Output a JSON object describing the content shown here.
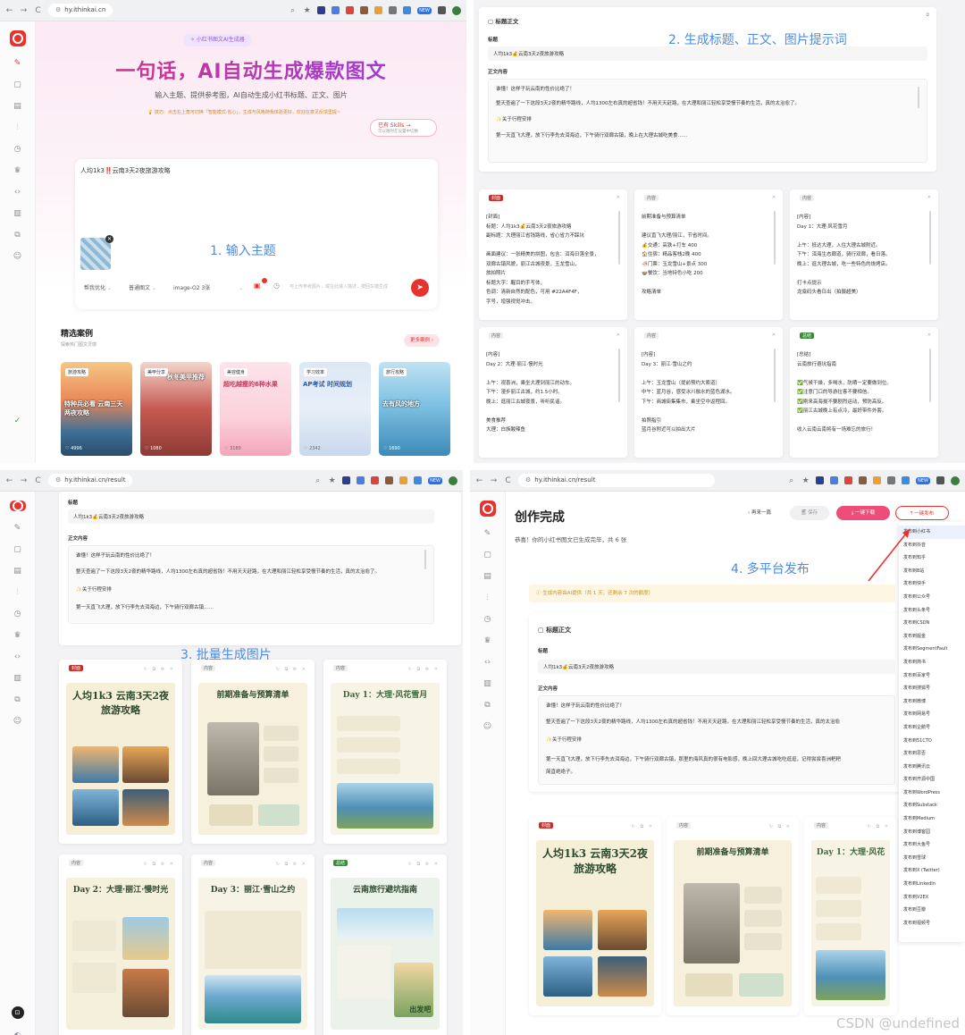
{
  "browser": {
    "url_home": "hy.ithinkai.cn",
    "url_result": "hy.ithinkai.cn/result",
    "nav": [
      "←",
      "→",
      "C"
    ]
  },
  "colors": {
    "brand": "#e8322e",
    "accent_blue": "#4a8ce6",
    "purple": "#9a56d6"
  },
  "p1": {
    "pill": "✧ 小红书图文AI生成器",
    "title": "一句话，AI自动生成爆款图文",
    "subtitle": "输入主题、提供参考图，AI自动生成小红书标题、正文、图片",
    "tip": "💡 技巧：点击右上角可切换「智能模式·省心」，生成与风格随我体验更好，欢迎在意见反馈里提~",
    "skill_line1": "已有 Skills →",
    "skill_line2": "可以随时在设置中切换",
    "input_text": "人均1k3‼️云南3天2夜旅游攻略",
    "step_label": "1. 输入主题",
    "ctrl_style": "帮我优化",
    "ctrl_type": "普通图文",
    "ctrl_model": "image-O2 3张",
    "placeholder": "可上传参考图片，或在此输入描述，按回车键生成",
    "section_title": "精选案例",
    "section_sub": "探索热门图文灵感",
    "more_btn": "更多案例 ›",
    "cases": [
      {
        "tag": "旅游攻略",
        "title": "特种兵必看 云南三天两夜攻略",
        "stat": "♡ 4996"
      },
      {
        "tag": "美甲分享",
        "title": "秋冬美甲推荐",
        "stat": "♡ 1080"
      },
      {
        "tag": "美容健身",
        "title": "超吃越瘦的6种水果",
        "stat": "♡ 3180"
      },
      {
        "tag": "学习效率",
        "title": "AP考试 时间规划",
        "stat": "♡ 2342"
      },
      {
        "tag": "旅行攻略",
        "title": "去有风的地方",
        "stat": "♡ 1690"
      }
    ]
  },
  "p2": {
    "header": "标题正文",
    "step_label": "2. 生成标题、正文、图片提示词",
    "title_label": "标题",
    "title_value": "人均1k3💰云南3天2夜旅游攻略",
    "body_label": "正文内容",
    "body_lines": [
      "谁懂！这样子玩云南的性价比绝了！",
      "整天查遍了一下这段3天2夜的精华路线，人均1300左右真的超省钱！不用天天赶路，在大理和丽江轻松享受慢节奏的生活，真的太治愈了。",
      "✨关于行程安排",
      "第一天直飞大理，放下行李先去洱海边，下午骑行双廊古镇，晚上在大理古城吃美食……"
    ],
    "pages": [
      {
        "tag": "封面",
        "style": "red",
        "lines": [
          "[封面]",
          "标题：人均1k3💰云南3天2夜旅游攻略",
          "副标题：大理丽江省钱路线，省心省力不踩坑",
          "",
          "画面建议：一张精美的拼图，包含：洱海日落全景，",
          "双廊古镇风貌，丽江古城夜景，玉龙雪山，",
          "旅拍照片",
          "标题大字：醒目的手写体，",
          "色调：清新自然的配色，可用 #22A4F4F，",
          "字号，增强视觉冲击。"
        ]
      },
      {
        "tag": "内容",
        "style": "gray",
        "lines": [
          "前期准备与预算清单",
          "",
          "建议直飞大理/丽江，节省时间。",
          "💰交通：高铁+打车 400",
          "🏠住宿：精品客栈2晚 400",
          "🍜门票：玉龙雪山+景点 300",
          "🍲餐饮：当地特色小吃 200",
          "",
          "攻略清单"
        ]
      },
      {
        "tag": "内容",
        "style": "gray",
        "lines": [
          "[内容]",
          "Day 1：大理·风花雪月",
          "",
          "上午：抵达大理，入住大理古城附近。",
          "下午：洱海生态廊道，骑行双廊，看日落。",
          "晚上：逛大理古城，吃一些特色的烧烤店。",
          "",
          "打卡点提示",
          "龙龛码头看日出（拍摄超美）"
        ]
      },
      {
        "tag": "内容",
        "style": "gray",
        "lines": [
          "[内容]",
          "Day 2：大理·丽江·慢时光",
          "",
          "上午：观喜洲，乘坐大理到丽江的动车。",
          "下午：漫步丽江古城，约1.5小时。",
          "晚上：逛丽江古城夜景，听听民谣。",
          "",
          "美食推荐",
          "大理：白族酸辣鱼"
        ]
      },
      {
        "tag": "内容",
        "style": "gray",
        "lines": [
          "[内容]",
          "Day 3：丽江·雪山之约",
          "",
          "上午：玉龙雪山（提前预约大索道）",
          "中午：蓝月谷，感受冰川融水的蓝色湖水。",
          "下午：商城街集集市，乘坐空中返程回。",
          "",
          "拍照指引",
          "蓝月谷附近可以拍出大片"
        ]
      },
      {
        "tag": "总结",
        "style": "grn",
        "lines": [
          "[总结]",
          "云南旅行避坑指南",
          "",
          "✅气候干燥，多喝水，防晒一定要做到位。",
          "✅注意门口的导游拉客不要相信。",
          "✅刚来高海拔不要剧烈运动，预防高反。",
          "✅丽江古城晚上有点冷，最好带件外套。",
          "",
          "收入云南云南将有一场难忘的旅行！"
        ]
      }
    ]
  },
  "p3": {
    "title_label": "标题",
    "title_value": "人均1k3💰云南3天2夜旅游攻略",
    "body_label": "正文内容",
    "body_lines": [
      "谁懂！这样子玩云南的性价比绝了！",
      "整天查遍了一下这段3天2夜的精华路线，人均1300左右真的超省钱！不用天天赶路，在大理和丽江轻松享受慢节奏的生活，真的太治愈了。",
      "✨关于行程安排",
      "第一天直飞大理，放下行李先去洱海边，下午骑行双廊古镇……"
    ],
    "step_label": "3. 批量生成图片",
    "images": [
      {
        "tag": "封面",
        "title": "人均1k3 云南3天2夜 旅游攻略"
      },
      {
        "tag": "内容",
        "title": "前期准备与预算清单"
      },
      {
        "tag": "内容",
        "title": "Day 1：大理·风花雪月"
      },
      {
        "tag": "内容",
        "title": "Day 2：大理·丽江·慢时光"
      },
      {
        "tag": "内容",
        "title": "Day 3：丽江·雪山之约"
      },
      {
        "tag": "总结",
        "title": "云南旅行避坑指南",
        "extra": "出发吧"
      }
    ]
  },
  "p4": {
    "title": "创作完成",
    "subtitle": "恭喜！你的小红书图文已生成完毕，共 6 张",
    "btn_back": "‹ 再来一篇",
    "btn_save": "🗐 保存",
    "btn_download": "⤓ 一键下载",
    "btn_publish": "⤒ 一键发布",
    "step_label": "4. 多平台发布",
    "notice": "ⓘ 生成内容由AI提供（共 1 天，还剩余 7 次的额度）",
    "section_header": "标题正文",
    "title_label": "标题",
    "title_value": "人均1k3💰云南3天2夜旅游攻略",
    "body_label": "正文内容",
    "body_lines": [
      "谁懂！这样子玩云南的性价比绝了！",
      "整天查遍了一下这段3天2夜的精华路线，人均1300左右真的超省钱！不用天天赶路，在大理和丽江轻松享受慢节奏的生活，真的太治愈",
      "✨关于行程安排",
      "第一天直飞大理，放下行李先去洱海边，下午骑行双廊古镇，那里的海风真的很有电影感，晚上回大理古城吃吃逛逛，记得尝尝喜洲粑粑",
      "简直绝绝子。"
    ],
    "images": [
      {
        "tag": "封面",
        "title": "人均1k3 云南3天2夜 旅游攻略"
      },
      {
        "tag": "内容",
        "title": "前期准备与预算清单"
      },
      {
        "tag": "内容",
        "title": "Day 1：大理·风花"
      }
    ],
    "menu": [
      "发布到小红书",
      "发布到抖音",
      "发布到知乎",
      "发布到B站",
      "发布到快手",
      "发布到公众号",
      "发布到头条号",
      "发布到CSDN",
      "发布到掘金",
      "发布到SegmentFault",
      "发布到简书",
      "发布到百家号",
      "发布到搜狐号",
      "发布到微博",
      "发布到网易号",
      "发布到企鹅号",
      "发布到51CTO",
      "发布到思否",
      "发布到腾讯云",
      "发布到开源中国",
      "发布到WordPress",
      "发布到Substack",
      "发布到Medium",
      "发布到博客园",
      "发布到大鱼号",
      "发布到雪球",
      "发布到X (Twitter)",
      "发布到LinkedIn",
      "发布到V2EX",
      "发布到豆瓣",
      "发布到视频号"
    ]
  },
  "watermark": "CSDN @undefined"
}
